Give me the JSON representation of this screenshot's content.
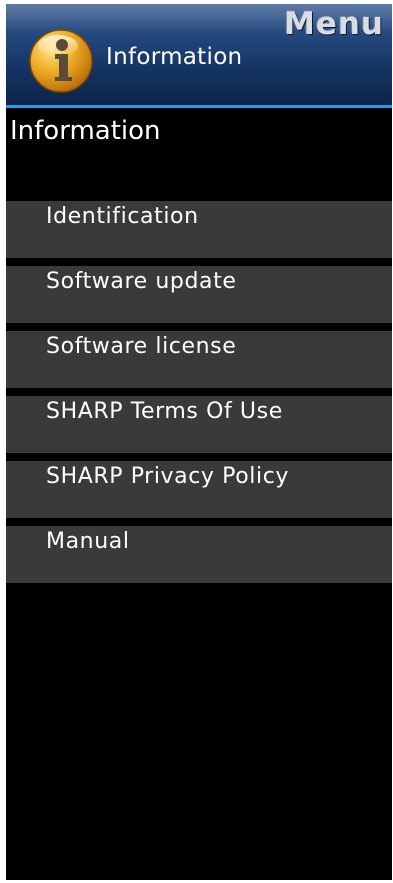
{
  "header": {
    "icon": "info-icon",
    "title": "Information",
    "menu_label": "Menu"
  },
  "section": {
    "title": "Information"
  },
  "menu": {
    "items": [
      {
        "label": "Identification"
      },
      {
        "label": "Software update"
      },
      {
        "label": "Software license"
      },
      {
        "label": "SHARP Terms Of Use"
      },
      {
        "label": "SHARP Privacy Policy"
      },
      {
        "label": "Manual"
      }
    ]
  },
  "colors": {
    "header_gradient_top": "#3a5f95",
    "header_gradient_bottom": "#0c2348",
    "header_accent_line": "#1f9ef0",
    "background": "#000000",
    "item_background": "#3a3a3a",
    "icon_gold": "#e6a21c",
    "text": "#ffffff"
  }
}
